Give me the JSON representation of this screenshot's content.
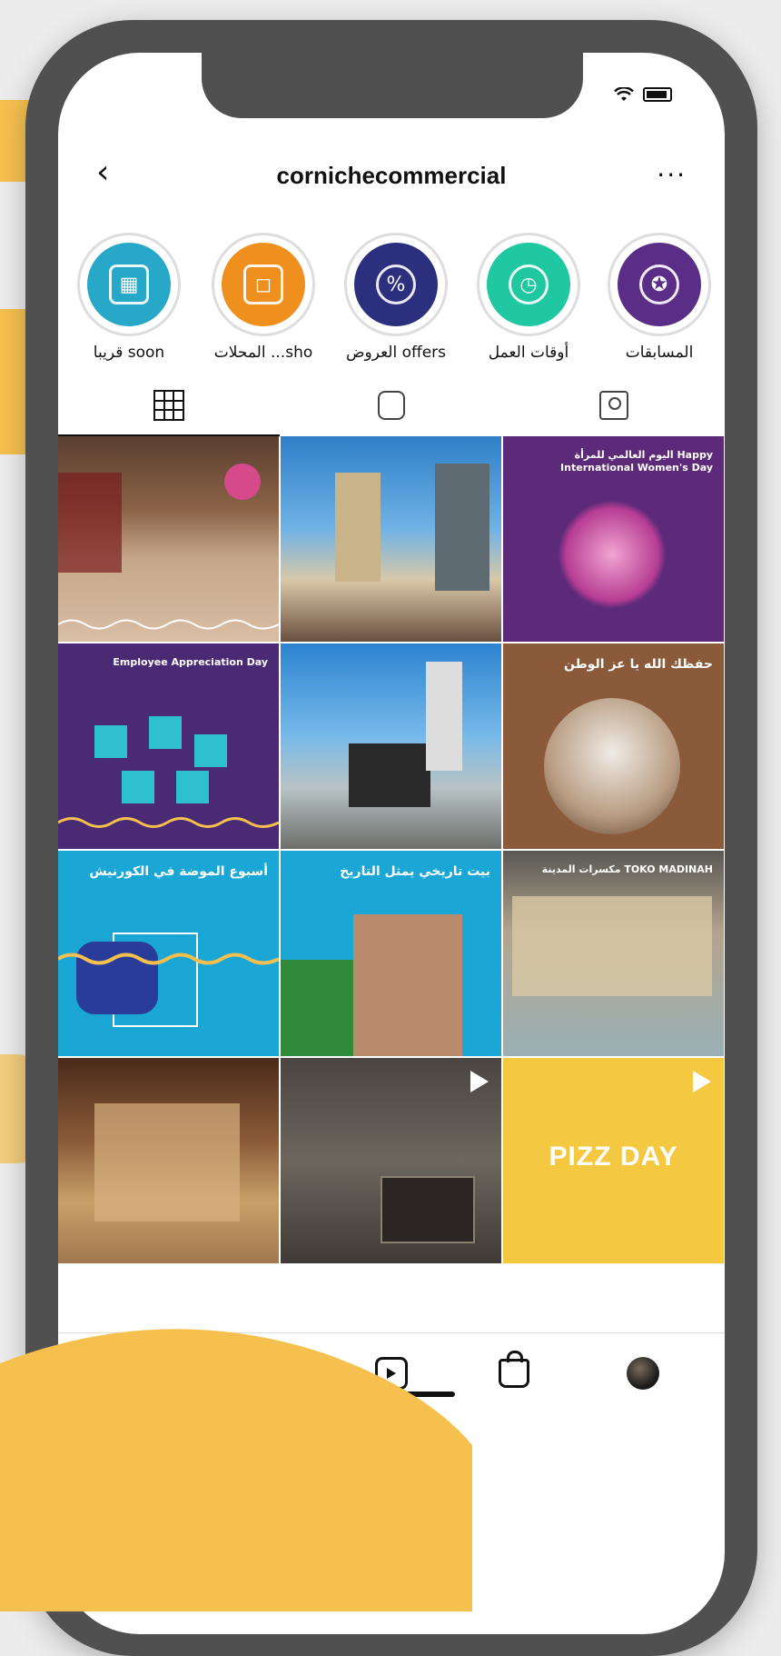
{
  "header": {
    "username": "cornichecommercial"
  },
  "highlights": [
    {
      "label": "قريبا soon",
      "color": "#27a8c8",
      "icon": "calendar-icon"
    },
    {
      "label": "المحلات ...sho",
      "color": "#ee8f1e",
      "icon": "shopping-bag-icon"
    },
    {
      "label": "العروض offers",
      "color": "#2b2f7e",
      "icon": "percent-badge-icon"
    },
    {
      "label": "أوقات العمل",
      "color": "#1fc8a0",
      "icon": "alarm-clock-icon"
    },
    {
      "label": "المسابقات",
      "color": "#5a2d86",
      "icon": "award-ribbon-icon"
    }
  ],
  "posts": [
    {
      "kind": "photo",
      "caption": "",
      "bg": "mall-interior",
      "play": false
    },
    {
      "kind": "photo",
      "caption": "",
      "bg": "tower-street",
      "play": false
    },
    {
      "kind": "graphic",
      "caption": "اليوم العالمي للمرأة Happy International Women's Day",
      "bg": "#5d2a7a",
      "play": false
    },
    {
      "kind": "graphic",
      "caption": "Employee Appreciation Day",
      "bg": "#4a2a74",
      "play": false
    },
    {
      "kind": "photo",
      "caption": "",
      "bg": "kiosk",
      "play": false
    },
    {
      "kind": "graphic",
      "caption": "حفظك الله يا عز الوطن",
      "bg": "#8a5a3a",
      "play": false
    },
    {
      "kind": "graphic",
      "caption": "أسبوع الموضة في الكورنيش",
      "bg": "#1aa7d6",
      "play": false
    },
    {
      "kind": "graphic",
      "caption": "بيت تاريخي يمثل التاريخ",
      "bg": "#1aa7d6",
      "play": false
    },
    {
      "kind": "photo",
      "caption": "مكسرات المدينة TOKO MADINAH",
      "bg": "shop-front",
      "play": false
    },
    {
      "kind": "photo",
      "caption": "",
      "bg": "shop-warm",
      "play": false
    },
    {
      "kind": "photo",
      "caption": "",
      "bg": "dark-texture",
      "play": true
    },
    {
      "kind": "graphic",
      "caption": "PIZZ DAY",
      "bg": "#f5c842",
      "play": true
    }
  ],
  "colors": {
    "ring": "#dddddd",
    "accent": "#f6c04f",
    "phone": "#505051"
  }
}
